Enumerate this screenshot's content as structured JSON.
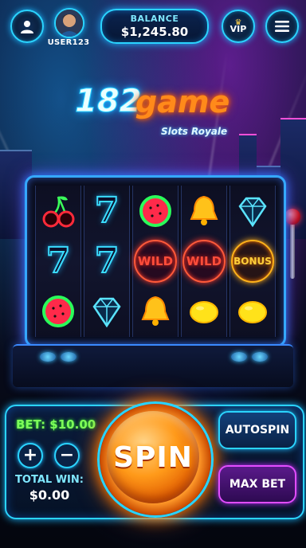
{
  "header": {
    "username": "USER123",
    "balance_label": "BALANCE",
    "balance_value": "$1,245.80",
    "vip_label": "VIP"
  },
  "logo": {
    "number": "182",
    "word": "game",
    "subtitle": "Slots Royale"
  },
  "reels": [
    [
      "cherry",
      "seven",
      "watermelon"
    ],
    [
      "seven",
      "seven",
      "diamond"
    ],
    [
      "watermelon",
      "WILD",
      "bell"
    ],
    [
      "bell",
      "WILD",
      "lemon"
    ],
    [
      "diamond",
      "BONUS",
      "lemon"
    ]
  ],
  "controls": {
    "bet_label": "BET: $10.00",
    "plus_label": "+",
    "minus_label": "−",
    "total_win_label": "TOTAL WIN:",
    "total_win_value": "$0.00",
    "spin_label": "SPIN",
    "autospin_label": "AUTOSPIN",
    "maxbet_label": "MAX BET"
  },
  "colors": {
    "neon_blue": "#2ad4ff",
    "neon_orange": "#ff8a1a",
    "bet_green": "#7dff5a",
    "max_bet_purple": "#e24dff"
  }
}
